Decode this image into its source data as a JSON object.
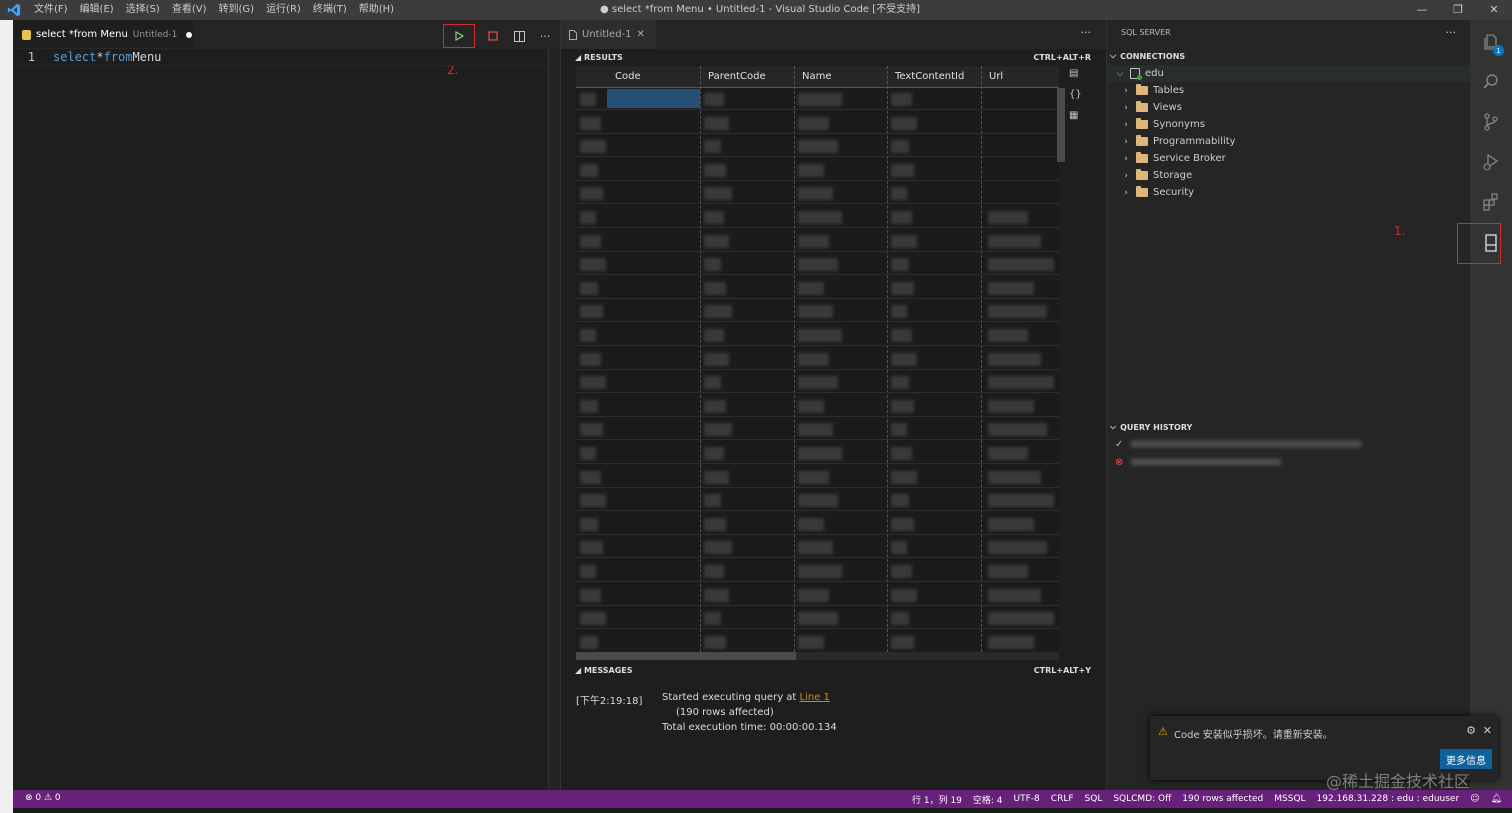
{
  "window": {
    "title": "● select *from Menu • Untitled-1 - Visual Studio Code [不受支持]",
    "menu": [
      "文件(F)",
      "编辑(E)",
      "选择(S)",
      "查看(V)",
      "转到(G)",
      "运行(R)",
      "终端(T)",
      "帮助(H)"
    ],
    "controls": [
      "—",
      "❐",
      "✕"
    ]
  },
  "editor": {
    "tab_label": "select *from Menu",
    "tab_sub": "Untitled-1",
    "line_number": "1",
    "code_kw1": "select",
    "code_rest1": " *",
    "code_kw2": "from",
    "code_rest2": " Menu",
    "annot_2": "2."
  },
  "results": {
    "tab_label": "Untitled-1",
    "results_header": "RESULTS",
    "results_shortcut": "CTRL+ALT+R",
    "columns": [
      "Code",
      "ParentCode",
      "Name",
      "TextContentId",
      "Url"
    ],
    "messages_header": "MESSAGES",
    "messages_shortcut": "CTRL+ALT+Y",
    "msg_time": "[下午2:19:18]",
    "msg_started": "Started executing query at ",
    "msg_link": "Line 1",
    "msg_rows": "(190 rows affected)",
    "msg_exec": "Total execution time: 00:00:00.134"
  },
  "sidebar": {
    "title": "SQL SERVER",
    "connections_header": "CONNECTIONS",
    "server": "edu",
    "folders": [
      "Tables",
      "Views",
      "Synonyms",
      "Programmability",
      "Service Broker",
      "Storage",
      "Security"
    ],
    "history_header": "QUERY HISTORY",
    "annot_1": "1."
  },
  "activity": {
    "badge": "1"
  },
  "notification": {
    "text": "Code 安装似乎损坏。请重新安装。",
    "button": "更多信息"
  },
  "watermark": "@稀土掘金技术社区",
  "status": {
    "problems": "⊗ 0 ⚠ 0",
    "position": "行 1，列 19",
    "spaces": "空格: 4",
    "encoding": "UTF-8",
    "eol": "CRLF",
    "language": "SQL",
    "sqlcmd": "SQLCMD: Off",
    "rows": "190 rows affected",
    "provider": "MSSQL",
    "connection": "192.168.31.228 : edu : eduuser"
  },
  "colors": {
    "statusbar": "#68217a",
    "accent_red": "#d12c2c",
    "selection": "#264f78"
  }
}
